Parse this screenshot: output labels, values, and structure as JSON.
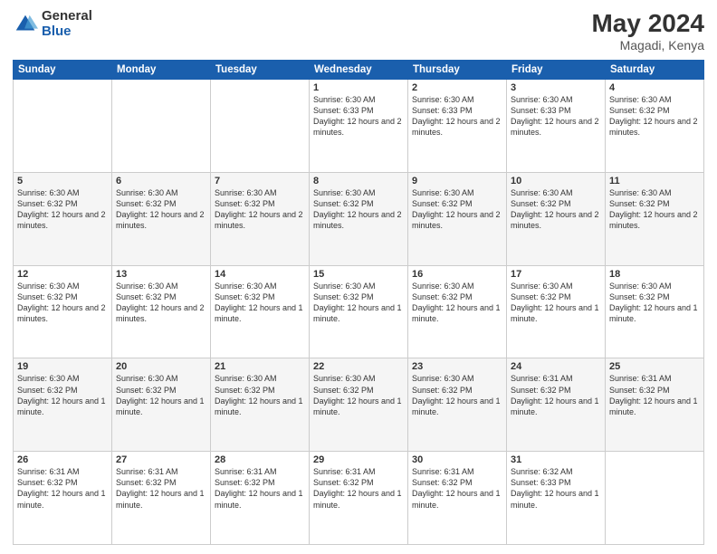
{
  "logo": {
    "general": "General",
    "blue": "Blue"
  },
  "header": {
    "month_year": "May 2024",
    "location": "Magadi, Kenya"
  },
  "weekdays": [
    "Sunday",
    "Monday",
    "Tuesday",
    "Wednesday",
    "Thursday",
    "Friday",
    "Saturday"
  ],
  "weeks": [
    [
      {
        "day": "",
        "sunrise": "",
        "sunset": "",
        "daylight": ""
      },
      {
        "day": "",
        "sunrise": "",
        "sunset": "",
        "daylight": ""
      },
      {
        "day": "",
        "sunrise": "",
        "sunset": "",
        "daylight": ""
      },
      {
        "day": "1",
        "sunrise": "Sunrise: 6:30 AM",
        "sunset": "Sunset: 6:33 PM",
        "daylight": "Daylight: 12 hours and 2 minutes."
      },
      {
        "day": "2",
        "sunrise": "Sunrise: 6:30 AM",
        "sunset": "Sunset: 6:33 PM",
        "daylight": "Daylight: 12 hours and 2 minutes."
      },
      {
        "day": "3",
        "sunrise": "Sunrise: 6:30 AM",
        "sunset": "Sunset: 6:33 PM",
        "daylight": "Daylight: 12 hours and 2 minutes."
      },
      {
        "day": "4",
        "sunrise": "Sunrise: 6:30 AM",
        "sunset": "Sunset: 6:32 PM",
        "daylight": "Daylight: 12 hours and 2 minutes."
      }
    ],
    [
      {
        "day": "5",
        "sunrise": "Sunrise: 6:30 AM",
        "sunset": "Sunset: 6:32 PM",
        "daylight": "Daylight: 12 hours and 2 minutes."
      },
      {
        "day": "6",
        "sunrise": "Sunrise: 6:30 AM",
        "sunset": "Sunset: 6:32 PM",
        "daylight": "Daylight: 12 hours and 2 minutes."
      },
      {
        "day": "7",
        "sunrise": "Sunrise: 6:30 AM",
        "sunset": "Sunset: 6:32 PM",
        "daylight": "Daylight: 12 hours and 2 minutes."
      },
      {
        "day": "8",
        "sunrise": "Sunrise: 6:30 AM",
        "sunset": "Sunset: 6:32 PM",
        "daylight": "Daylight: 12 hours and 2 minutes."
      },
      {
        "day": "9",
        "sunrise": "Sunrise: 6:30 AM",
        "sunset": "Sunset: 6:32 PM",
        "daylight": "Daylight: 12 hours and 2 minutes."
      },
      {
        "day": "10",
        "sunrise": "Sunrise: 6:30 AM",
        "sunset": "Sunset: 6:32 PM",
        "daylight": "Daylight: 12 hours and 2 minutes."
      },
      {
        "day": "11",
        "sunrise": "Sunrise: 6:30 AM",
        "sunset": "Sunset: 6:32 PM",
        "daylight": "Daylight: 12 hours and 2 minutes."
      }
    ],
    [
      {
        "day": "12",
        "sunrise": "Sunrise: 6:30 AM",
        "sunset": "Sunset: 6:32 PM",
        "daylight": "Daylight: 12 hours and 2 minutes."
      },
      {
        "day": "13",
        "sunrise": "Sunrise: 6:30 AM",
        "sunset": "Sunset: 6:32 PM",
        "daylight": "Daylight: 12 hours and 2 minutes."
      },
      {
        "day": "14",
        "sunrise": "Sunrise: 6:30 AM",
        "sunset": "Sunset: 6:32 PM",
        "daylight": "Daylight: 12 hours and 1 minute."
      },
      {
        "day": "15",
        "sunrise": "Sunrise: 6:30 AM",
        "sunset": "Sunset: 6:32 PM",
        "daylight": "Daylight: 12 hours and 1 minute."
      },
      {
        "day": "16",
        "sunrise": "Sunrise: 6:30 AM",
        "sunset": "Sunset: 6:32 PM",
        "daylight": "Daylight: 12 hours and 1 minute."
      },
      {
        "day": "17",
        "sunrise": "Sunrise: 6:30 AM",
        "sunset": "Sunset: 6:32 PM",
        "daylight": "Daylight: 12 hours and 1 minute."
      },
      {
        "day": "18",
        "sunrise": "Sunrise: 6:30 AM",
        "sunset": "Sunset: 6:32 PM",
        "daylight": "Daylight: 12 hours and 1 minute."
      }
    ],
    [
      {
        "day": "19",
        "sunrise": "Sunrise: 6:30 AM",
        "sunset": "Sunset: 6:32 PM",
        "daylight": "Daylight: 12 hours and 1 minute."
      },
      {
        "day": "20",
        "sunrise": "Sunrise: 6:30 AM",
        "sunset": "Sunset: 6:32 PM",
        "daylight": "Daylight: 12 hours and 1 minute."
      },
      {
        "day": "21",
        "sunrise": "Sunrise: 6:30 AM",
        "sunset": "Sunset: 6:32 PM",
        "daylight": "Daylight: 12 hours and 1 minute."
      },
      {
        "day": "22",
        "sunrise": "Sunrise: 6:30 AM",
        "sunset": "Sunset: 6:32 PM",
        "daylight": "Daylight: 12 hours and 1 minute."
      },
      {
        "day": "23",
        "sunrise": "Sunrise: 6:30 AM",
        "sunset": "Sunset: 6:32 PM",
        "daylight": "Daylight: 12 hours and 1 minute."
      },
      {
        "day": "24",
        "sunrise": "Sunrise: 6:31 AM",
        "sunset": "Sunset: 6:32 PM",
        "daylight": "Daylight: 12 hours and 1 minute."
      },
      {
        "day": "25",
        "sunrise": "Sunrise: 6:31 AM",
        "sunset": "Sunset: 6:32 PM",
        "daylight": "Daylight: 12 hours and 1 minute."
      }
    ],
    [
      {
        "day": "26",
        "sunrise": "Sunrise: 6:31 AM",
        "sunset": "Sunset: 6:32 PM",
        "daylight": "Daylight: 12 hours and 1 minute."
      },
      {
        "day": "27",
        "sunrise": "Sunrise: 6:31 AM",
        "sunset": "Sunset: 6:32 PM",
        "daylight": "Daylight: 12 hours and 1 minute."
      },
      {
        "day": "28",
        "sunrise": "Sunrise: 6:31 AM",
        "sunset": "Sunset: 6:32 PM",
        "daylight": "Daylight: 12 hours and 1 minute."
      },
      {
        "day": "29",
        "sunrise": "Sunrise: 6:31 AM",
        "sunset": "Sunset: 6:32 PM",
        "daylight": "Daylight: 12 hours and 1 minute."
      },
      {
        "day": "30",
        "sunrise": "Sunrise: 6:31 AM",
        "sunset": "Sunset: 6:32 PM",
        "daylight": "Daylight: 12 hours and 1 minute."
      },
      {
        "day": "31",
        "sunrise": "Sunrise: 6:32 AM",
        "sunset": "Sunset: 6:33 PM",
        "daylight": "Daylight: 12 hours and 1 minute."
      },
      {
        "day": "",
        "sunrise": "",
        "sunset": "",
        "daylight": ""
      }
    ]
  ]
}
